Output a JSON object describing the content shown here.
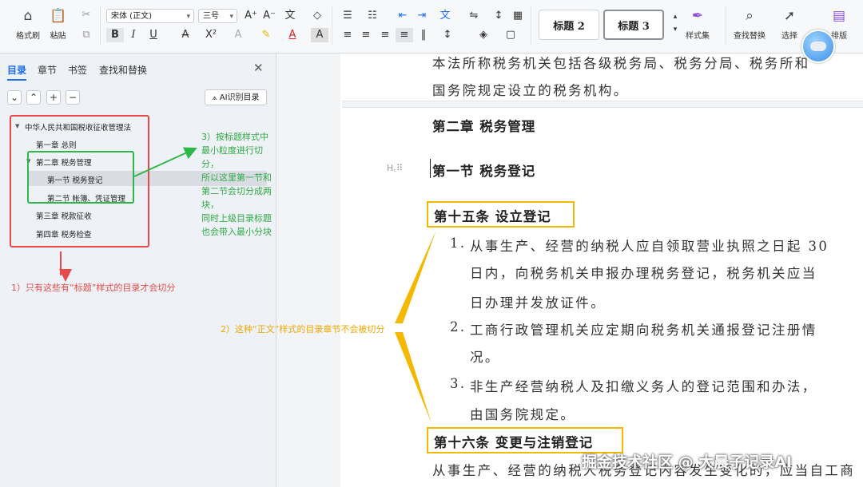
{
  "ribbon": {
    "format_painter": "格式刷",
    "paste": "粘贴",
    "font_name": "宋体 (正文)",
    "font_size": "三号",
    "style_h2": "标题 2",
    "style_h3": "标题 3",
    "style_set": "样式集",
    "find_replace": "查找替换",
    "select": "选择",
    "layout": "排版"
  },
  "nav": {
    "tabs": [
      "目录",
      "章节",
      "书签",
      "查找和替换"
    ],
    "ai_button": "AI识别目录",
    "toc": {
      "root": "中华人民共和国税收征收管理法",
      "ch1": "第一章 总则",
      "ch2": "第二章 税务管理",
      "sec1": "第一节 税务登记",
      "sec2": "第二节 帐簿、凭证管理",
      "ch3": "第三章 税款征收",
      "ch4": "第四章 税务检查"
    }
  },
  "annotations": {
    "red": "1）只有这些有“标题”样式的目录才会切分",
    "green_1": "3）按标题样式中最小粒度进行切分，",
    "green_2": "所以这里第一节和第二节会切分成两块，",
    "green_3": "同时上级目录标题也会带入最小分块",
    "orange": "2）这种“正文”样式的目录章节不会被切分"
  },
  "doc": {
    "line1": "本法所称税务机关包括各级税务局、税务分局、税务所和",
    "line2": "国务院规定设立的税务机构。",
    "chapter2": "第二章 税务管理",
    "section1": "第一节 税务登记",
    "art15": "第十五条 设立登记",
    "item1_num": "1.",
    "item1_l1": "从事生产、经营的纳税人应自领取营业执照之日起 30",
    "item1_l2": "日内，向税务机关申报办理税务登记，税务机关应当",
    "item1_l3": "日办理并发放证件。",
    "item2_num": "2.",
    "item2_l1": "工商行政管理机关应定期向税务机关通报登记注册情",
    "item2_l2": "况。",
    "item3_num": "3.",
    "item3_l1": "非生产经营纳税人及扣缴义务人的登记范围和办法，",
    "item3_l2": "由国务院规定。",
    "art16": "第十六条 变更与注销登记",
    "last_line": "从事生产、经营的纳税人税务登记内容发生变化的，应当自工商"
  },
  "watermark": "掘金技术社区 @ 大晨子记录AI",
  "colors": {
    "accent": "#1e6ef0",
    "red": "#e84a4a",
    "green": "#2eb84a",
    "orange": "#f5b800"
  }
}
